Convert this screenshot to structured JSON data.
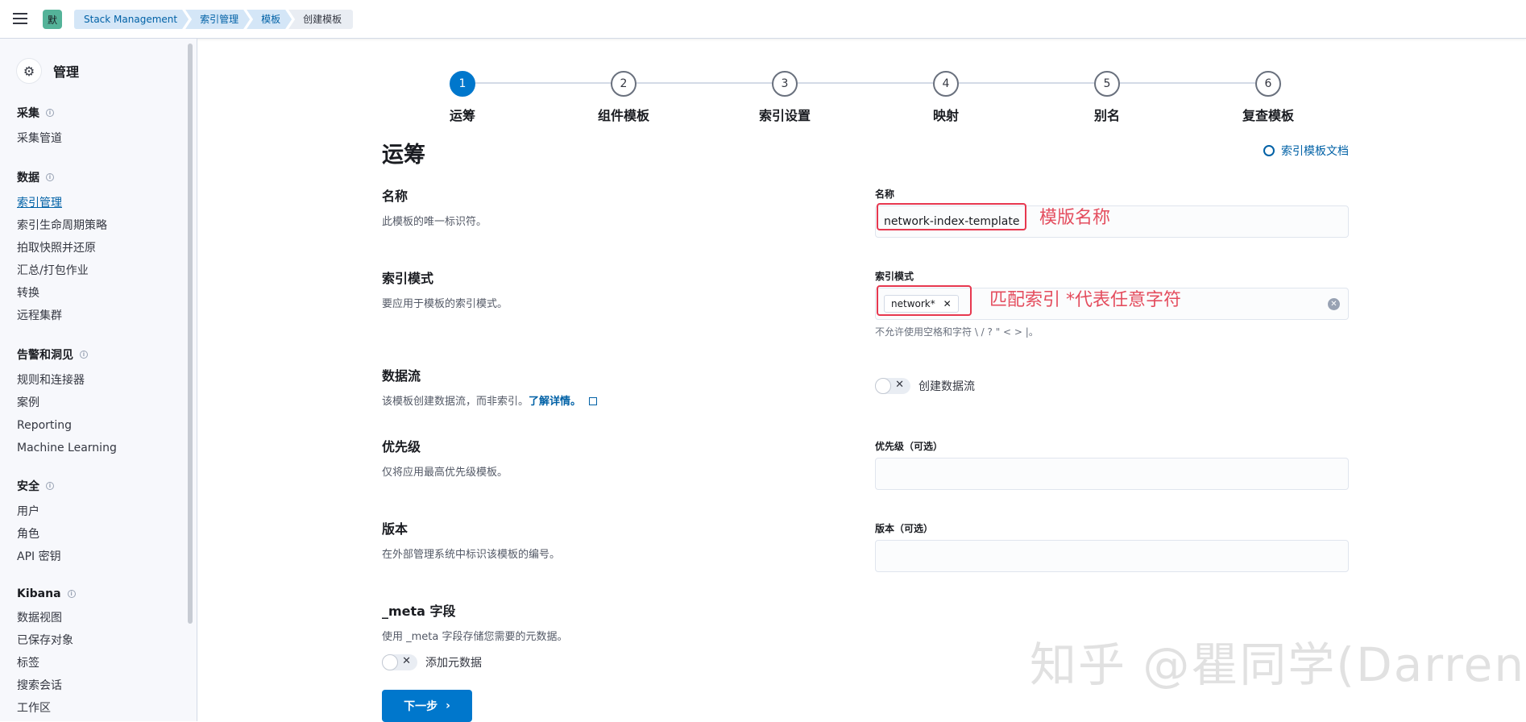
{
  "topbar": {
    "space_avatar": "默",
    "breadcrumbs": [
      "Stack Management",
      "索引管理",
      "模板",
      "创建模板"
    ]
  },
  "sidebar": {
    "title": "管理",
    "groups": [
      {
        "title": "采集",
        "items": [
          "采集管道"
        ]
      },
      {
        "title": "数据",
        "items": [
          "索引管理",
          "索引生命周期策略",
          "拍取快照并还原",
          "汇总/打包作业",
          "转换",
          "远程集群"
        ]
      },
      {
        "title": "告警和洞见",
        "items": [
          "规则和连接器",
          "案例",
          "Reporting",
          "Machine Learning"
        ]
      },
      {
        "title": "安全",
        "items": [
          "用户",
          "角色",
          "API 密钥"
        ]
      },
      {
        "title": "Kibana",
        "items": [
          "数据视图",
          "已保存对象",
          "标签",
          "搜索会话",
          "工作区"
        ]
      }
    ],
    "active_item": "索引管理"
  },
  "stepper": {
    "steps": [
      {
        "num": "1",
        "label": "运筹"
      },
      {
        "num": "2",
        "label": "组件模板"
      },
      {
        "num": "3",
        "label": "索引设置"
      },
      {
        "num": "4",
        "label": "映射"
      },
      {
        "num": "5",
        "label": "别名"
      },
      {
        "num": "6",
        "label": "复查模板"
      }
    ],
    "active_step": 1
  },
  "page": {
    "title": "运筹",
    "doc_link": "索引模板文档"
  },
  "form": {
    "name": {
      "title": "名称",
      "desc": "此模板的唯一标识符。",
      "label": "名称",
      "value": "network-index-template",
      "annotation": "模版名称"
    },
    "pattern": {
      "title": "索引模式",
      "desc": "要应用于模板的索引模式。",
      "label": "索引模式",
      "chip": "network*",
      "annotation": "匹配索引 *代表任意字符",
      "help": "不允许使用空格和字符 \\ / ? \" < > |。"
    },
    "datastream": {
      "title": "数据流",
      "desc": "该模板创建数据流，而非索引。",
      "link": "了解详情。",
      "toggle_label": "创建数据流"
    },
    "priority": {
      "title": "优先级",
      "desc": "仅将应用最高优先级模板。",
      "label": "优先级（可选）",
      "value": ""
    },
    "version": {
      "title": "版本",
      "desc": "在外部管理系统中标识该模板的编号。",
      "label": "版本（可选）",
      "value": ""
    },
    "meta": {
      "title": "_meta 字段",
      "desc": "使用 _meta 字段存储您需要的元数据。",
      "toggle_label": "添加元数据"
    }
  },
  "buttons": {
    "next": "下一步"
  },
  "watermark": "知乎 @瞿同学(Darren)",
  "colors": {
    "primary": "#0077cc",
    "annotation": "#e7384f",
    "link": "#0061a6"
  }
}
